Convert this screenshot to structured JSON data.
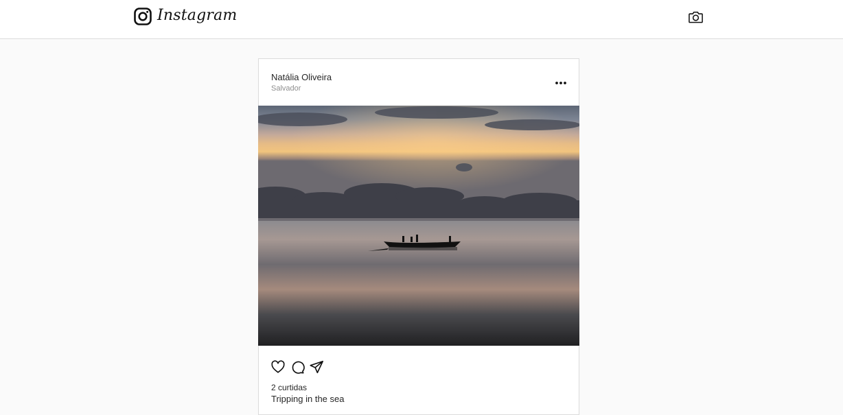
{
  "header": {
    "brand": "Instagram",
    "logo_icon": "instagram-logo-icon",
    "camera_icon": "camera-icon"
  },
  "post": {
    "username": "Natália Oliveira",
    "location": "Salvador",
    "more_icon": "more-options-icon",
    "photo_description_icon": "sunset-boat-photo",
    "actions": {
      "like_icon": "heart-icon",
      "comment_icon": "comment-icon",
      "share_icon": "send-icon"
    },
    "likes_text": "2 curtidas",
    "caption": "Tripping in the sea"
  }
}
